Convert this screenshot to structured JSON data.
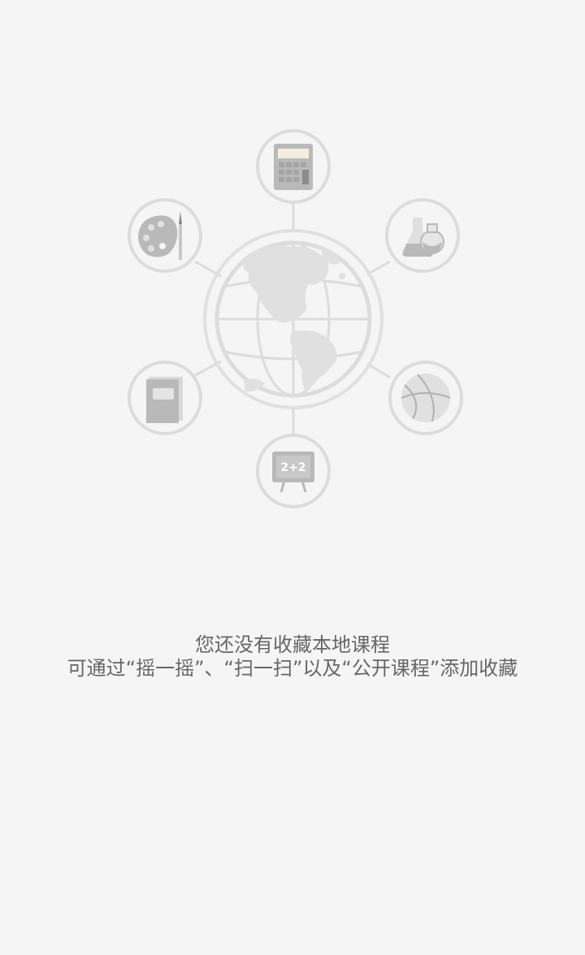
{
  "empty_state": {
    "title": "您还没有收藏本地课程",
    "hint": "可通过“摇一摇”、“扫一扫”以及“公开课程”添加收藏"
  },
  "illustration": {
    "center_icon": "globe-icon",
    "satellite_icons": [
      "calculator-icon",
      "lab-flask-icon",
      "basketball-icon",
      "blackboard-icon",
      "book-icon",
      "palette-icon"
    ],
    "blackboard_text": "2+2",
    "colors": {
      "ring": "#dcdcdc",
      "icon_dark": "#b9b9b9",
      "icon_light": "#e4e4e4",
      "background": "#f5f5f5",
      "text": "#666666"
    }
  }
}
